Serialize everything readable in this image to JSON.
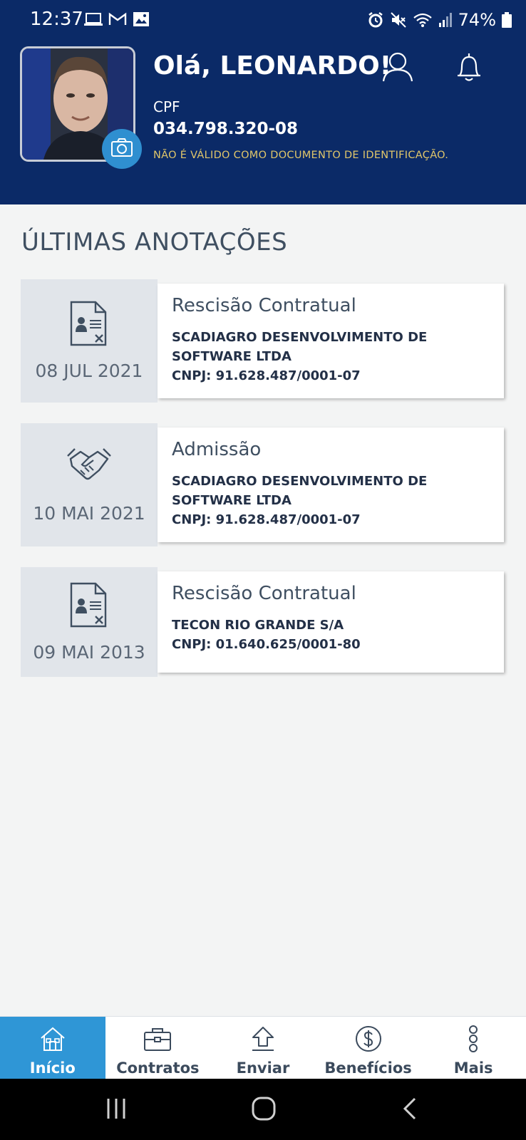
{
  "status_bar": {
    "time": "12:37",
    "battery": "74%",
    "left_icons": [
      "laptop-icon",
      "gmail-icon",
      "image-icon"
    ],
    "right_icons": [
      "alarm-icon",
      "mute-icon",
      "wifi-icon",
      "signal-icon",
      "battery-icon"
    ]
  },
  "header": {
    "greeting": "Olá, LEONARDO!",
    "cpf_label": "CPF",
    "cpf_value": "034.798.320-08",
    "warning": "NÃO É VÁLIDO COMO DOCUMENTO DE IDENTIFICAÇÃO.",
    "background_color": "#0b2a67",
    "warning_color": "#e0c66a"
  },
  "main": {
    "section_title": "ÚLTIMAS ANOTAÇÕES",
    "annotations": [
      {
        "icon": "document-cancel-icon",
        "date": "08 JUL 2021",
        "type": "Rescisão Contratual",
        "company": "SCADIAGRO DESENVOLVIMENTO DE SOFTWARE LTDA",
        "cnpj": "CNPJ: 91.628.487/0001-07"
      },
      {
        "icon": "handshake-icon",
        "date": "10 MAI 2021",
        "type": "Admissão",
        "company": "SCADIAGRO DESENVOLVIMENTO DE SOFTWARE LTDA",
        "cnpj": "CNPJ: 91.628.487/0001-07"
      },
      {
        "icon": "document-cancel-icon",
        "date": "09 MAI 2013",
        "type": "Rescisão Contratual",
        "company": "TECON RIO GRANDE S/A",
        "cnpj": "CNPJ: 01.640.625/0001-80"
      }
    ]
  },
  "bottom_nav": {
    "active_color": "#2f96d6",
    "items": [
      {
        "label": "Início",
        "icon": "home-icon",
        "active": true
      },
      {
        "label": "Contratos",
        "icon": "briefcase-icon",
        "active": false
      },
      {
        "label": "Enviar",
        "icon": "upload-icon",
        "active": false
      },
      {
        "label": "Benefícios",
        "icon": "dollar-icon",
        "active": false
      },
      {
        "label": "Mais",
        "icon": "more-vertical-icon",
        "active": false
      }
    ]
  }
}
